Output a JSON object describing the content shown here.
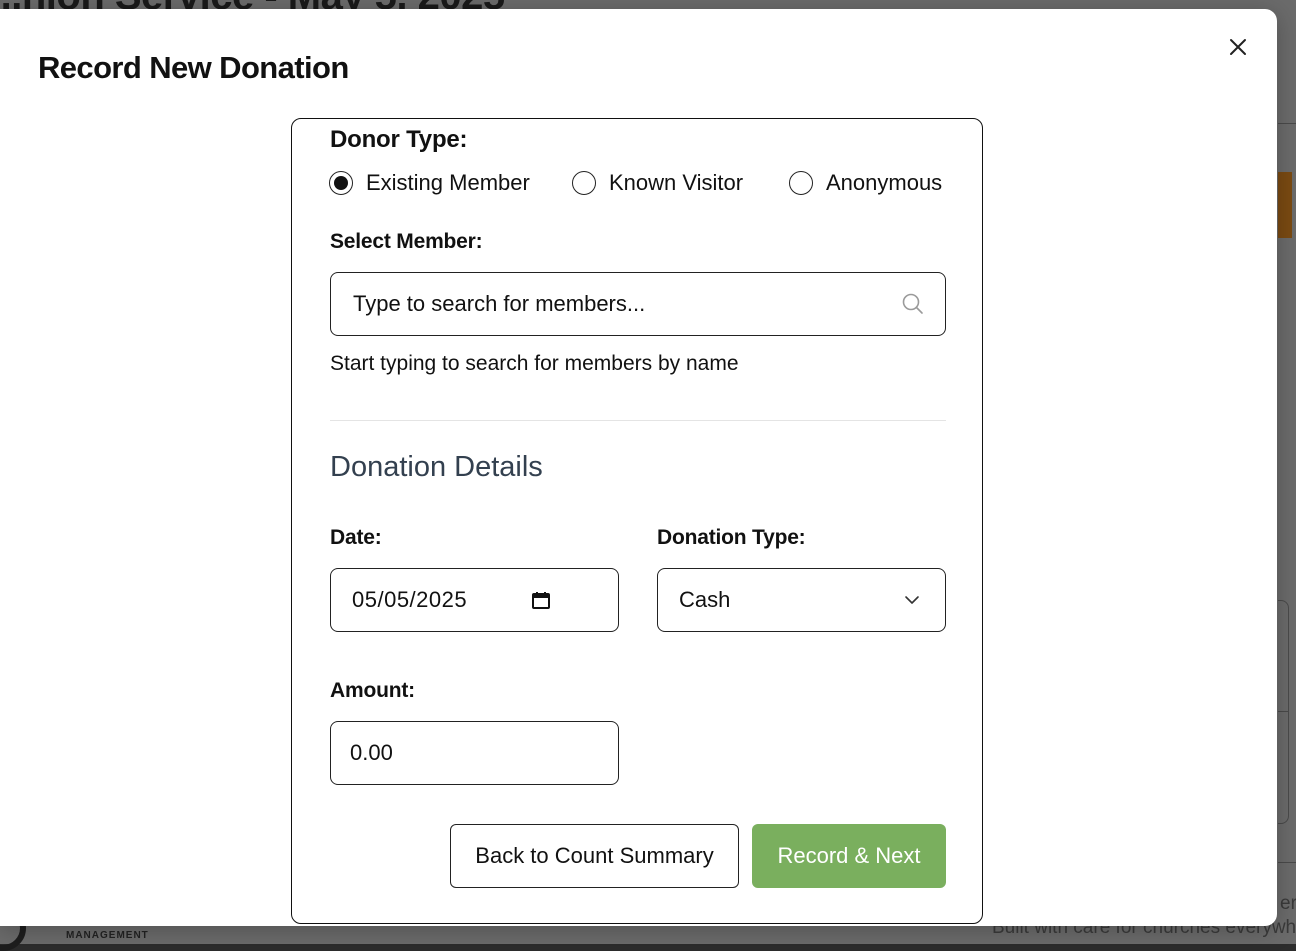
{
  "background": {
    "page_title": "...nion Service - May 5, 2025",
    "logo_text": "MANAGEMENT",
    "footer_text": "Built with care for churches everywh",
    "footer_text_2": "er"
  },
  "modal": {
    "title": "Record New Donation",
    "close_icon": "close-icon"
  },
  "donor_type": {
    "label": "Donor Type:",
    "options": [
      {
        "label": "Existing Member",
        "selected": true
      },
      {
        "label": "Known Visitor",
        "selected": false
      },
      {
        "label": "Anonymous",
        "selected": false
      }
    ]
  },
  "member": {
    "label": "Select Member:",
    "search_placeholder": "Type to search for members...",
    "search_icon": "search-icon",
    "helper": "Start typing to search for members by name"
  },
  "details": {
    "heading": "Donation Details",
    "date_label": "Date:",
    "date_value": "05/05/2025",
    "type_label": "Donation Type:",
    "type_value": "Cash",
    "amount_label": "Amount:",
    "amount_value": "0.00"
  },
  "actions": {
    "back_label": "Back to Count Summary",
    "record_label": "Record & Next"
  },
  "colors": {
    "primary_button": "#7aaf5e",
    "section_heading": "#33404f"
  }
}
